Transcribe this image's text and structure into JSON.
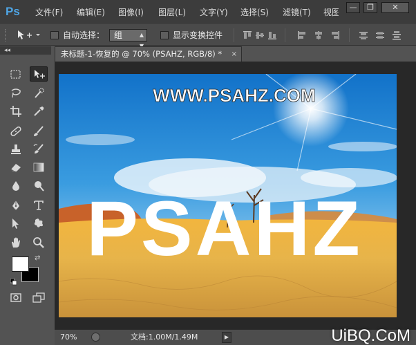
{
  "app": {
    "logo": "Ps"
  },
  "menu": {
    "items": [
      "文件(F)",
      "编辑(E)",
      "图像(I)",
      "图层(L)",
      "文字(Y)",
      "选择(S)",
      "滤镜(T)",
      "视图"
    ]
  },
  "window_controls": {
    "minimize": "—",
    "restore": "❐",
    "close": "✕"
  },
  "options": {
    "tool_glyph": "▸✥",
    "auto_select_label": "自动选择：",
    "auto_select_value": "组",
    "show_transform_label": "显示变换控件"
  },
  "panel": {
    "collapse_glyph": "◂◂"
  },
  "document": {
    "tab_title": "未标题-1-恢复的 @ 70% (PSAHZ, RGB/8) *",
    "tab_close": "×"
  },
  "canvas": {
    "header_text": "WWW.PSAHZ.COM",
    "big_text": "PSAHZ"
  },
  "status": {
    "zoom": "70%",
    "doc_info": "文档:1.00M/1.49M",
    "arrow": "▶"
  },
  "watermark": {
    "text": "UiBQ.CoM"
  },
  "colors": {
    "accent": "#4fa6e6",
    "menubar_bg": "#3c3c3c",
    "ui_bg": "#535353",
    "canvas_bg": "#282828",
    "foreground_swatch": "#ffffff",
    "background_swatch": "#000000"
  }
}
